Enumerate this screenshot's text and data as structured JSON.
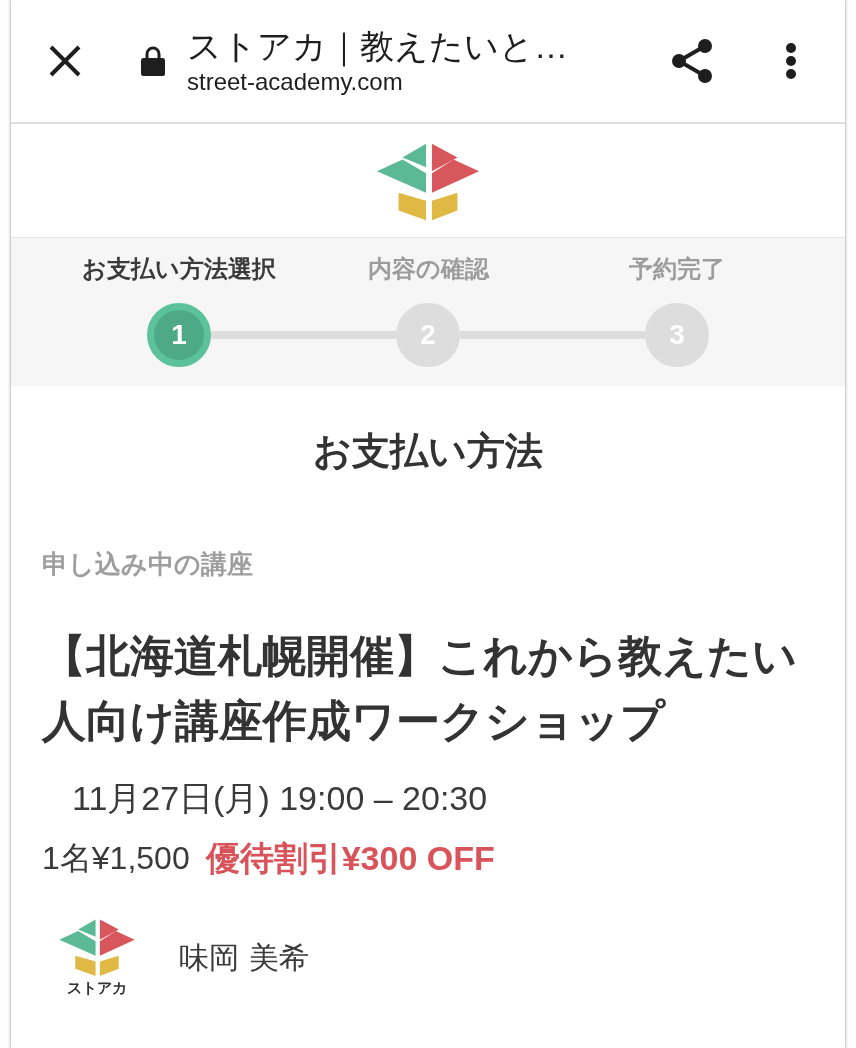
{
  "browser_bar": {
    "title": "ストアカ｜教えたいと…",
    "url": "street-academy.com"
  },
  "steps": [
    {
      "label": "お支払い方法選択",
      "number": "1",
      "selected": true
    },
    {
      "label": "内容の確認",
      "number": "2",
      "selected": false
    },
    {
      "label": "予約完了",
      "number": "3",
      "selected": false
    }
  ],
  "page_heading": "お支払い方法",
  "course": {
    "section_label": "申し込み中の講座",
    "title": "【北海道札幌開催】これから教えたい人向け講座作成ワークショップ",
    "schedule": "11月27日(月) 19:00 – 20:30",
    "price": "1名¥1,500",
    "discount": "優待割引¥300 OFF"
  },
  "instructor": {
    "logo_text": "ストアカ",
    "name": "味岡 美希"
  }
}
